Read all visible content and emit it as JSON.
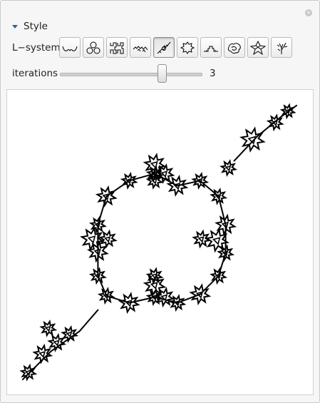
{
  "panel": {
    "section_title": "Style"
  },
  "lsystem": {
    "label": "L−system",
    "options": [
      {
        "icon": "koch-curve-icon"
      },
      {
        "icon": "trefoil-icon"
      },
      {
        "icon": "hilbert-curve-icon"
      },
      {
        "icon": "dragon-curve-icon"
      },
      {
        "icon": "diagonal-fractal-icon"
      },
      {
        "icon": "snowflake-icon"
      },
      {
        "icon": "hat-curve-icon"
      },
      {
        "icon": "swirl-curve-icon"
      },
      {
        "icon": "cross-star-icon"
      },
      {
        "icon": "fractal-plant-icon"
      }
    ],
    "selected_index": 4
  },
  "iterations": {
    "label": "iterations",
    "value": "3",
    "min": 0,
    "max": 4,
    "level": 3
  },
  "colors": {
    "accent": "#2a62b0",
    "stroke": "#000000"
  }
}
